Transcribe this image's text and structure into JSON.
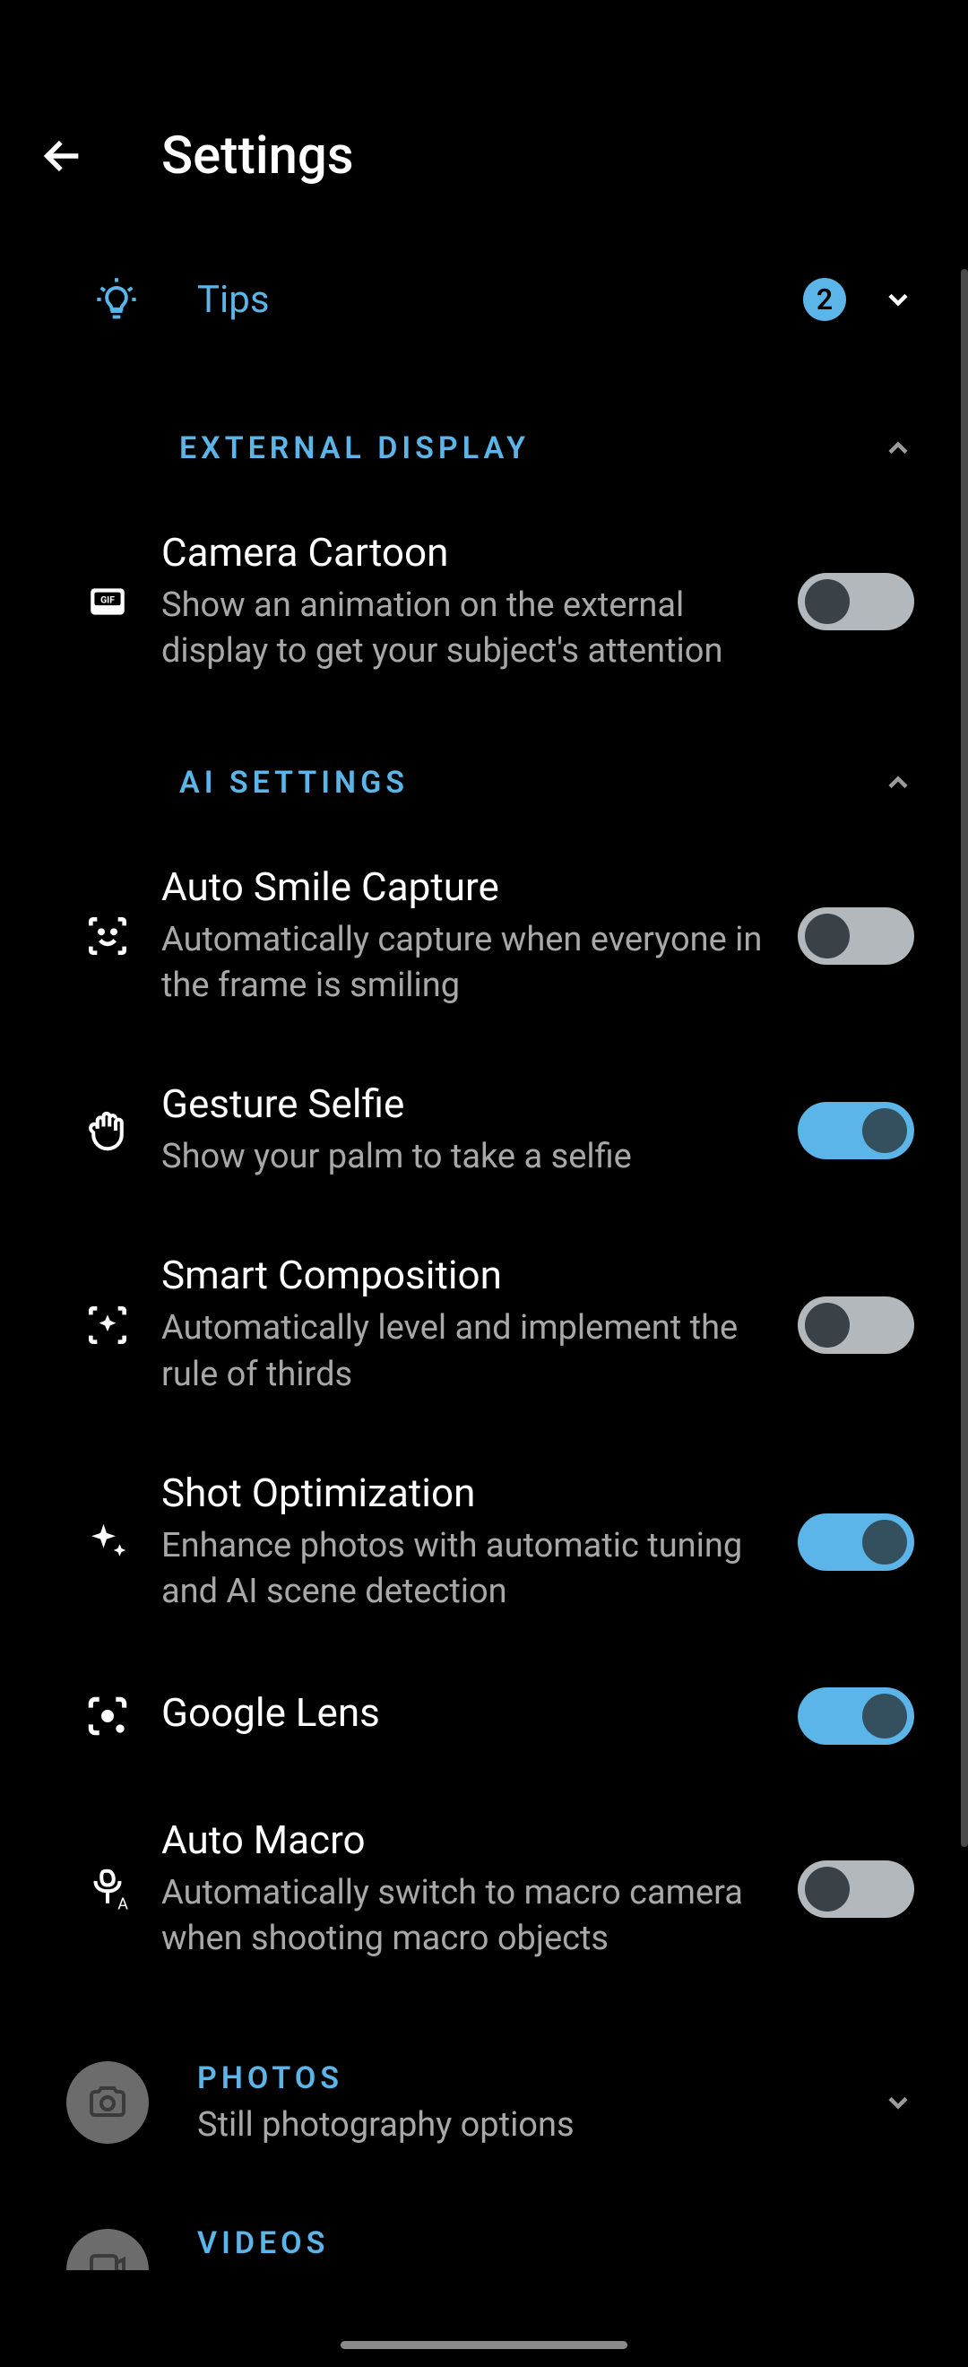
{
  "header": {
    "title": "Settings"
  },
  "tips": {
    "label": "Tips",
    "badge": "2"
  },
  "sections": {
    "external_display": {
      "title": "EXTERNAL DISPLAY",
      "items": {
        "camera_cartoon": {
          "title": "Camera Cartoon",
          "sub": "Show an animation on the external display to get your subject's attention",
          "on": false
        }
      }
    },
    "ai_settings": {
      "title": "AI SETTINGS",
      "items": {
        "auto_smile": {
          "title": "Auto Smile Capture",
          "sub": "Automatically capture when everyone in the frame is smiling",
          "on": false
        },
        "gesture_selfie": {
          "title": "Gesture Selfie",
          "sub": "Show your palm to take a selfie",
          "on": true
        },
        "smart_composition": {
          "title": "Smart Composition",
          "sub": "Automatically level and implement the rule of thirds",
          "on": false
        },
        "shot_optimization": {
          "title": "Shot Optimization",
          "sub": "Enhance photos with automatic tuning and AI scene detection",
          "on": true
        },
        "google_lens": {
          "title": "Google Lens",
          "on": true
        },
        "auto_macro": {
          "title": "Auto Macro",
          "sub": "Automatically switch to macro camera when shooting macro objects",
          "on": false
        }
      }
    }
  },
  "categories": {
    "photos": {
      "title": "PHOTOS",
      "sub": "Still photography options"
    },
    "videos": {
      "title": "VIDEOS"
    }
  }
}
